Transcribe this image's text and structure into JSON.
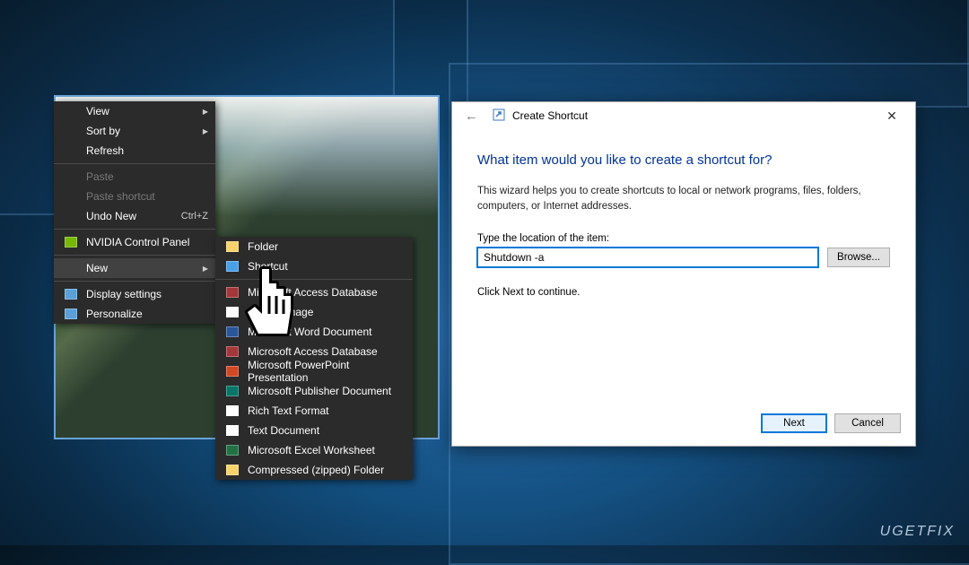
{
  "context_menu_1": {
    "items": [
      {
        "label": "View",
        "submenu": true
      },
      {
        "label": "Sort by",
        "submenu": true
      },
      {
        "label": "Refresh"
      },
      {
        "sep": true
      },
      {
        "label": "Paste",
        "disabled": true
      },
      {
        "label": "Paste shortcut",
        "disabled": true
      },
      {
        "label": "Undo New",
        "shortcut": "Ctrl+Z"
      },
      {
        "sep": true
      },
      {
        "label": "NVIDIA Control Panel",
        "icon": "nvidia",
        "icon_color": "#76b900"
      },
      {
        "sep": true
      },
      {
        "label": "New",
        "submenu": true,
        "hover": true
      },
      {
        "sep": true
      },
      {
        "label": "Display settings",
        "icon": "display",
        "icon_color": "#5aa0d8"
      },
      {
        "label": "Personalize",
        "icon": "personalize",
        "icon_color": "#5aa0d8"
      }
    ]
  },
  "context_menu_2": {
    "items": [
      {
        "label": "Folder",
        "icon_color": "#f8d26a"
      },
      {
        "label": "Shortcut",
        "icon_color": "#4aa0e8"
      },
      {
        "sep": true
      },
      {
        "label": "Microsoft Access Database",
        "icon_color": "#a4373a"
      },
      {
        "label": "Bitmap image",
        "icon_color": "#ffffff"
      },
      {
        "label": "Microsoft Word Document",
        "icon_color": "#2b579a"
      },
      {
        "label": "Microsoft Access Database",
        "icon_color": "#a4373a"
      },
      {
        "label": "Microsoft PowerPoint Presentation",
        "icon_color": "#d24726"
      },
      {
        "label": "Microsoft Publisher Document",
        "icon_color": "#077568"
      },
      {
        "label": "Rich Text Format",
        "icon_color": "#ffffff"
      },
      {
        "label": "Text Document",
        "icon_color": "#ffffff"
      },
      {
        "label": "Microsoft Excel Worksheet",
        "icon_color": "#217346"
      },
      {
        "label": "Compressed (zipped) Folder",
        "icon_color": "#f8d26a"
      }
    ]
  },
  "wizard": {
    "title": "Create Shortcut",
    "heading": "What item would you like to create a shortcut for?",
    "description": "This wizard helps you to create shortcuts to local or network programs, files, folders, computers, or Internet addresses.",
    "location_label": "Type the location of the item:",
    "location_value": "Shutdown -a",
    "browse_label": "Browse...",
    "continue_text": "Click Next to continue.",
    "next_label": "Next",
    "cancel_label": "Cancel"
  },
  "watermark": "UGETFIX"
}
